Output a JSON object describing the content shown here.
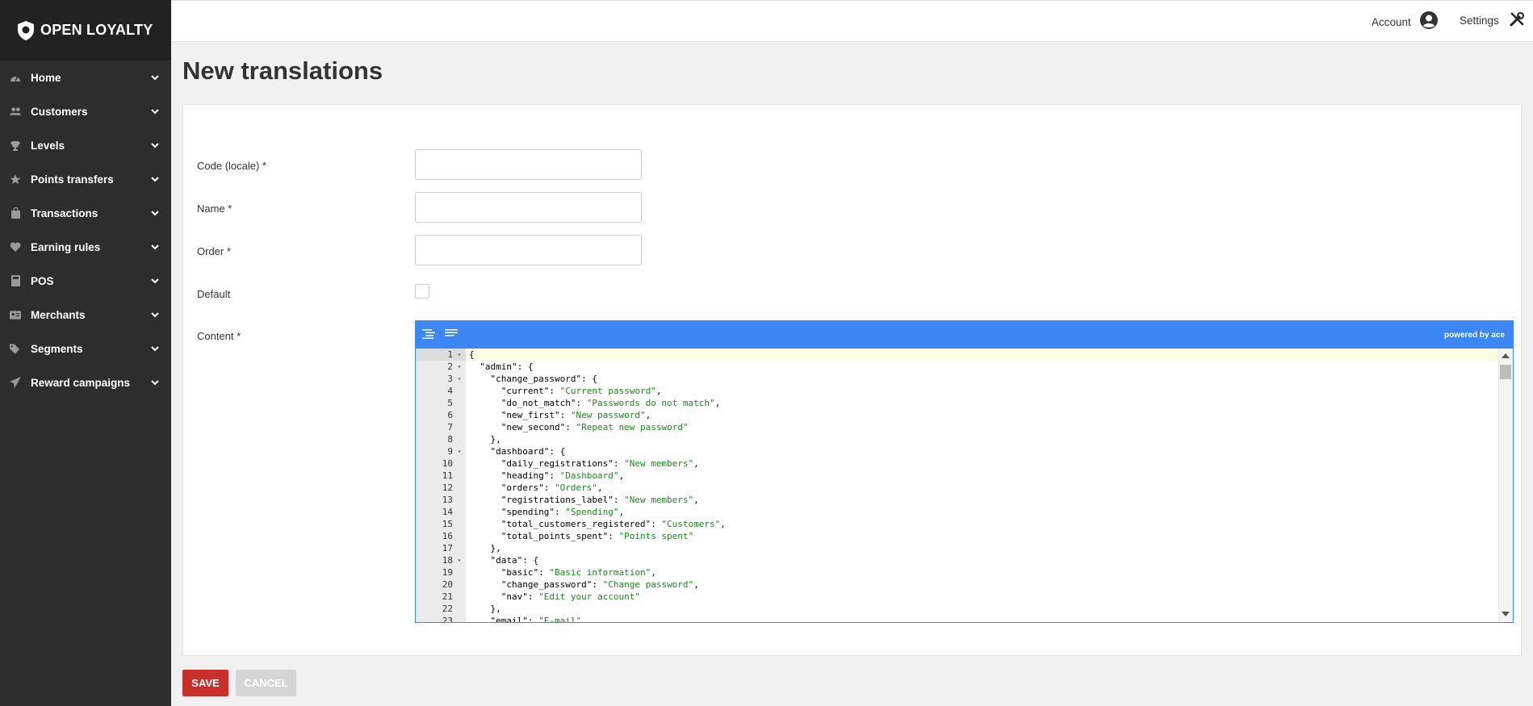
{
  "brand": {
    "name": "OPEN LOYALTY"
  },
  "sidebar": {
    "items": [
      {
        "label": "Home",
        "icon": "dashboard-icon"
      },
      {
        "label": "Customers",
        "icon": "users-icon"
      },
      {
        "label": "Levels",
        "icon": "trophy-icon"
      },
      {
        "label": "Points transfers",
        "icon": "star-icon"
      },
      {
        "label": "Transactions",
        "icon": "shopping-bag-icon"
      },
      {
        "label": "Earning rules",
        "icon": "heart-icon"
      },
      {
        "label": "POS",
        "icon": "pos-terminal-icon"
      },
      {
        "label": "Merchants",
        "icon": "id-card-icon"
      },
      {
        "label": "Segments",
        "icon": "tags-icon"
      },
      {
        "label": "Reward campaigns",
        "icon": "paper-plane-icon"
      }
    ]
  },
  "header": {
    "account_label": "Account",
    "settings_label": "Settings"
  },
  "page": {
    "title": "New translations"
  },
  "form": {
    "code_label": "Code (locale) *",
    "code_value": "",
    "name_label": "Name *",
    "name_value": "",
    "order_label": "Order *",
    "order_value": "",
    "default_label": "Default",
    "default_checked": false,
    "content_label": "Content *"
  },
  "editor": {
    "brand": "powered by ace",
    "lines": [
      {
        "n": "1",
        "fold": true,
        "text": "{"
      },
      {
        "n": "2",
        "fold": true,
        "text": "  \"admin\": {"
      },
      {
        "n": "3",
        "fold": true,
        "text": "    \"change_password\": {"
      },
      {
        "n": "4",
        "fold": false,
        "text": "      \"current\": \"Current password\","
      },
      {
        "n": "5",
        "fold": false,
        "text": "      \"do_not_match\": \"Passwords do not match\","
      },
      {
        "n": "6",
        "fold": false,
        "text": "      \"new_first\": \"New password\","
      },
      {
        "n": "7",
        "fold": false,
        "text": "      \"new_second\": \"Repeat new password\""
      },
      {
        "n": "8",
        "fold": false,
        "text": "    },"
      },
      {
        "n": "9",
        "fold": true,
        "text": "    \"dashboard\": {"
      },
      {
        "n": "10",
        "fold": false,
        "text": "      \"daily_registrations\": \"New members\","
      },
      {
        "n": "11",
        "fold": false,
        "text": "      \"heading\": \"Dashboard\","
      },
      {
        "n": "12",
        "fold": false,
        "text": "      \"orders\": \"Orders\","
      },
      {
        "n": "13",
        "fold": false,
        "text": "      \"registrations_label\": \"New members\","
      },
      {
        "n": "14",
        "fold": false,
        "text": "      \"spending\": \"Spending\","
      },
      {
        "n": "15",
        "fold": false,
        "text": "      \"total_customers_registered\": \"Customers\","
      },
      {
        "n": "16",
        "fold": false,
        "text": "      \"total_points_spent\": \"Points spent\""
      },
      {
        "n": "17",
        "fold": false,
        "text": "    },"
      },
      {
        "n": "18",
        "fold": true,
        "text": "    \"data\": {"
      },
      {
        "n": "19",
        "fold": false,
        "text": "      \"basic\": \"Basic information\","
      },
      {
        "n": "20",
        "fold": false,
        "text": "      \"change_password\": \"Change password\","
      },
      {
        "n": "21",
        "fold": false,
        "text": "      \"nav\": \"Edit your account\""
      },
      {
        "n": "22",
        "fold": false,
        "text": "    },"
      },
      {
        "n": "23",
        "fold": false,
        "text": "    \"email\": \"E-mail\","
      }
    ]
  },
  "actions": {
    "save_label": "SAVE",
    "cancel_label": "CANCEL"
  },
  "colors": {
    "sidebar_bg": "#2d2d2d",
    "accent_blue": "#3c86f5",
    "save_red": "#c9302c",
    "string_green": "#1a8a1a"
  }
}
